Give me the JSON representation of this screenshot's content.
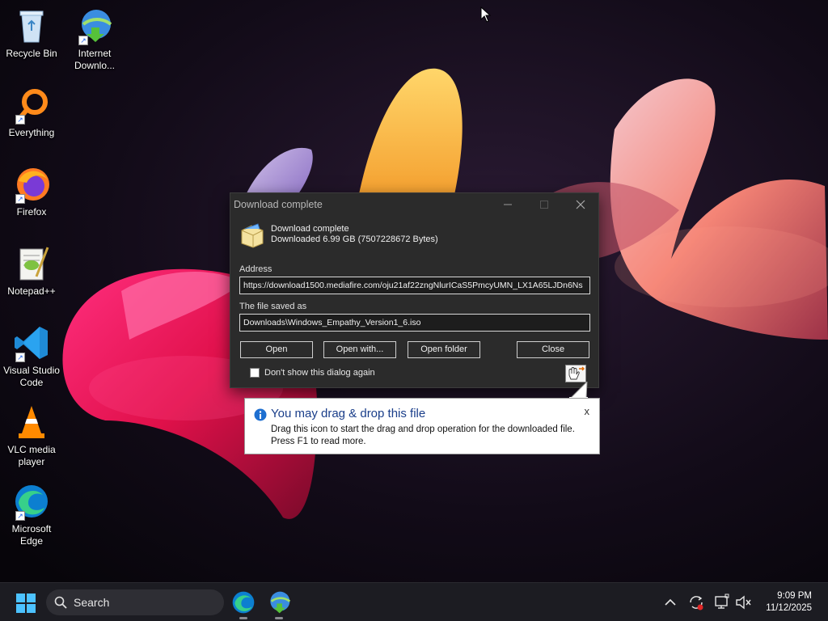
{
  "desktop": {
    "icons": [
      {
        "label": "Recycle Bin"
      },
      {
        "label": "Internet Downlo..."
      },
      {
        "label": "Everything"
      },
      {
        "label": "Firefox"
      },
      {
        "label": "Notepad++"
      },
      {
        "label": "Visual Studio Code"
      },
      {
        "label": "VLC media player"
      },
      {
        "label": "Microsoft Edge"
      }
    ]
  },
  "dialog": {
    "title": "Download complete",
    "heading": "Download complete",
    "size_text": "Downloaded 6.99  GB (7507228672 Bytes)",
    "address_label": "Address",
    "address_value": "https://download1500.mediafire.com/oju21af22zngNlurICaS5PmcyUMN_LX1A65LJDn6Ns",
    "saved_label": "The file saved as",
    "saved_value": "Downloads\\Windows_Empathy_Version1_6.iso",
    "buttons": {
      "open": "Open",
      "open_with": "Open with...",
      "open_folder": "Open folder",
      "close": "Close"
    },
    "checkbox_label": "Don't show this dialog again",
    "checkbox_checked": false
  },
  "balloon": {
    "title": "You may drag & drop this file",
    "line1": "Drag this icon to start the drag and drop operation for the downloaded file.",
    "line2": "Press F1 to read more.",
    "close": "x"
  },
  "taskbar": {
    "search_label": "Search",
    "time": "9:09 PM",
    "date": "11/12/2025"
  },
  "colors": {
    "dialog_bg": "#2b2b2b",
    "taskbar_bg": "#1c1c22",
    "balloon_title": "#1a3e8a",
    "accent_blue": "#0078d4"
  }
}
